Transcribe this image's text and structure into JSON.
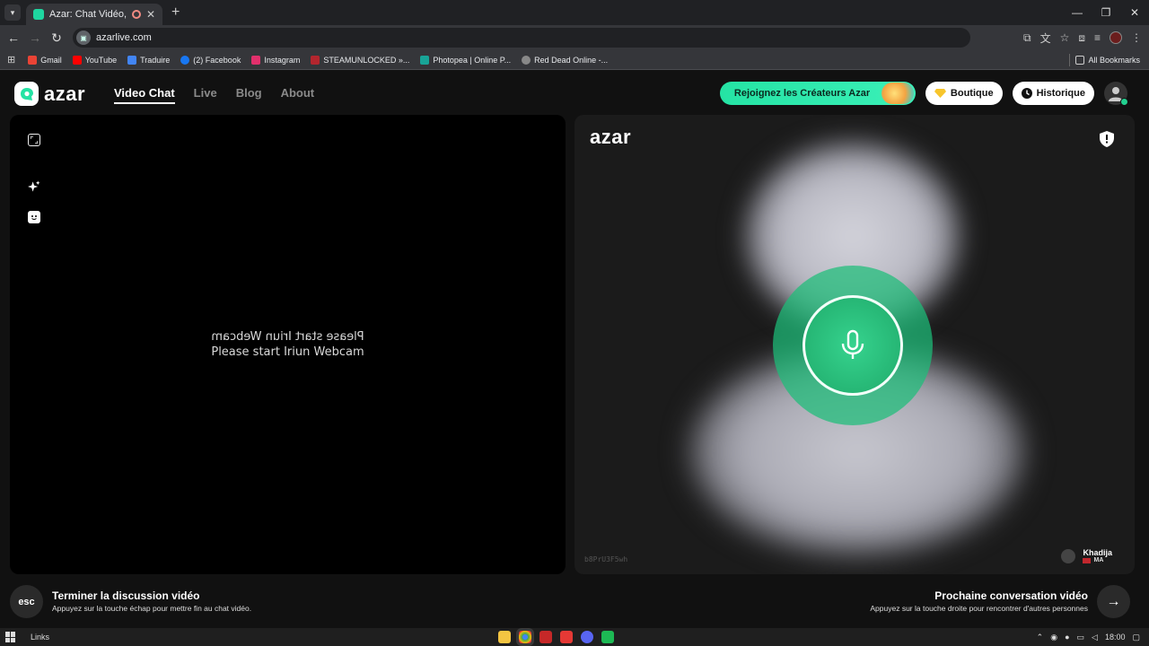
{
  "browser": {
    "tab_title": "Azar: Chat Vidéo, Rencontr",
    "url": "azarlive.com",
    "window_controls": [
      "—",
      "❐",
      "✕"
    ],
    "bookmarks": [
      {
        "label": "Gmail",
        "color": "#ea4335"
      },
      {
        "label": "YouTube",
        "color": "#ff0000"
      },
      {
        "label": "Traduire",
        "color": "#4285f4"
      },
      {
        "label": "(2) Facebook",
        "color": "#1877f2"
      },
      {
        "label": "Instagram",
        "color": "#e1306c"
      },
      {
        "label": "STEAMUNLOCKED »...",
        "color": "#b3262e"
      },
      {
        "label": "Photopea | Online P...",
        "color": "#18a497"
      },
      {
        "label": "Red Dead Online -...",
        "color": "#888888"
      }
    ],
    "all_bookmarks": "All Bookmarks"
  },
  "header": {
    "brand": "azar",
    "nav": [
      {
        "label": "Video Chat",
        "active": true
      },
      {
        "label": "Live",
        "active": false
      },
      {
        "label": "Blog",
        "active": false
      },
      {
        "label": "About",
        "active": false
      }
    ],
    "creators_label": "Rejoignez les Créateurs Azar",
    "shop_label": "Boutique",
    "history_label": "Historique"
  },
  "left_panel": {
    "webcam_message": "Please start Iriun Webcam"
  },
  "right_panel": {
    "brand": "azar",
    "session_id": "b8PrU3F5wh",
    "peer_name": "Khadija",
    "peer_country": "MA"
  },
  "footer": {
    "esc_label": "esc",
    "end_title": "Terminer la discussion vidéo",
    "end_subtitle": "Appuyez sur la touche échap pour mettre fin au chat vidéo.",
    "next_title": "Prochaine conversation vidéo",
    "next_subtitle": "Appuyez sur la touche droite pour rencontrer d'autres personnes"
  },
  "taskbar": {
    "links_label": "Links",
    "time": "18:00",
    "apps": [
      {
        "name": "file-explorer",
        "color": "#f4c542"
      },
      {
        "name": "chrome",
        "color": "#4caf50",
        "active": true
      },
      {
        "name": "app-red",
        "color": "#c62828"
      },
      {
        "name": "app-rec",
        "color": "#e53935"
      },
      {
        "name": "discord",
        "color": "#5865f2"
      },
      {
        "name": "app-green",
        "color": "#1db954"
      }
    ]
  },
  "colors": {
    "accent": "#25e3a4",
    "mic_green": "#1faa6a"
  }
}
